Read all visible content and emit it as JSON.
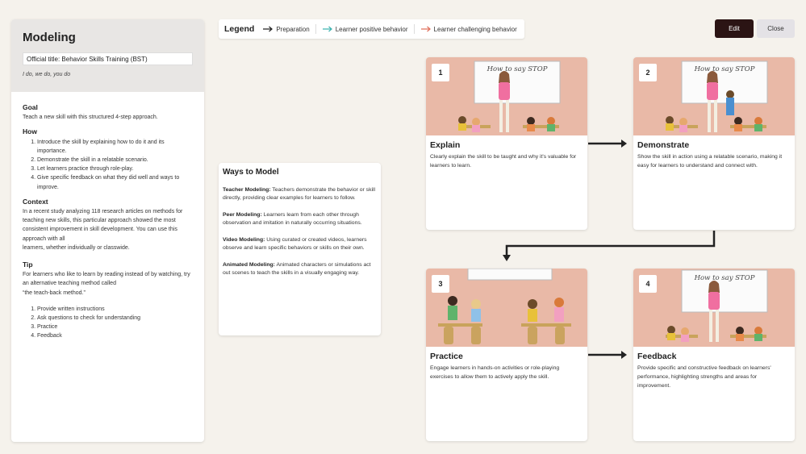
{
  "left": {
    "title": "Modeling",
    "official_title": "Official title: Behavior Skills Training (BST)",
    "subtitle": "I do, we do, you do",
    "goal_heading": "Goal",
    "goal_text": "Teach a new skill with this structured 4-step approach.",
    "how_heading": "How",
    "how_items": [
      "Introduce the skill by explaining how to do it and its importance.",
      "Demonstrate the skill in a relatable scenario.",
      "Let learners practice through role-play.",
      "Give specific feedback on what they did well and ways to improve."
    ],
    "context_heading": "Context",
    "context_text": "In a recent study analyzing 118 research articles on methods for teaching new skills, this particular approach showed the most consistent improvement in skill development. You can use this approach with all",
    "context_text2": "learners, whether individually or classwide.",
    "tip_heading": "Tip",
    "tip_text": "For learners who like to learn by reading instead of by watching, try an alternative teaching method called",
    "tip_text2": "“the teach-back method.”",
    "tip_items": [
      "Provide written instructions",
      "Ask questions to check for understanding",
      "Practice",
      "Feedback"
    ]
  },
  "legend": {
    "title": "Legend",
    "items": [
      {
        "label": "Preparation",
        "color": "#222222"
      },
      {
        "label": "Learner positive behavior",
        "color": "#3fb3b0"
      },
      {
        "label": "Learner challenging behavior",
        "color": "#e0705c"
      }
    ]
  },
  "buttons": {
    "edit": "Edit",
    "close": "Close"
  },
  "ways": {
    "title": "Ways to Model",
    "items": [
      {
        "label": "Teacher Modeling:",
        "text": " Teachers demonstrate the behavior or skill directly, providing clear examples for learners to follow."
      },
      {
        "label": "Peer Modeling:",
        "text": " Learners learn from each other through observation and imitation in naturally occurring situations."
      },
      {
        "label": "Video Modeling:",
        "text": " Using curated or created videos, learners observe and learn specific behaviors or skills on their own."
      },
      {
        "label": "Animated Modeling:",
        "text": " Animated characters or simulations act out scenes to teach the skills in a visually engaging way."
      }
    ]
  },
  "steps": [
    {
      "num": "1",
      "title": "Explain",
      "board": "How to say STOP",
      "desc": "Clearly explain the skill to be taught and why it's valuable for learners to learn."
    },
    {
      "num": "2",
      "title": "Demonstrate",
      "board": "How to say STOP",
      "desc": "Show the skill in action using a relatable scenario, making it easy for learners to understand and connect with."
    },
    {
      "num": "3",
      "title": "Practice",
      "desc": "Engage learners in hands-on activities or role-playing exercises to allow them to actively apply the skill."
    },
    {
      "num": "4",
      "title": "Feedback",
      "board": "How to say STOP",
      "desc": "Provide specific and constructive feedback on learners' performance, highlighting strengths and areas for improvement."
    }
  ],
  "colors": {
    "scene_bg": "#e9b9a7",
    "edit_button": "#2b1414"
  }
}
